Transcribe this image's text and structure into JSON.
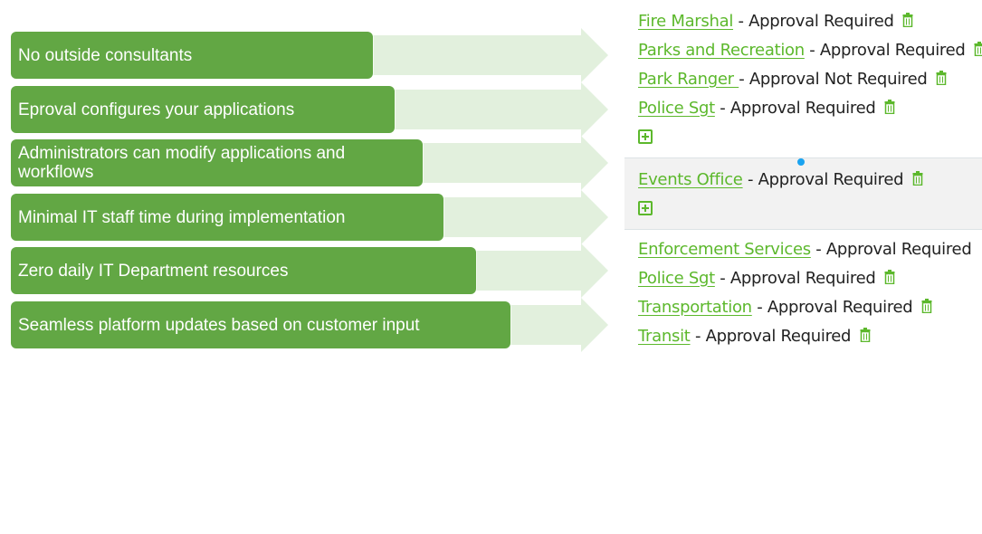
{
  "benefits": [
    "No outside consultants",
    "Eproval configures your applications",
    "Administrators can modify applications and workflows",
    "Minimal IT staff time during implementation",
    "Zero daily IT Department resources",
    "Seamless platform updates based on customer input"
  ],
  "colors": {
    "box_green": "#62a744",
    "arrow_green": "#e2f0dd",
    "link_green": "#5cb82c",
    "shaded_bg": "#f2f2f2",
    "cursor_blue": "#1aa3f0"
  },
  "approvals": {
    "group1": [
      {
        "name": "Fire Marshal",
        "status": "- Approval Required"
      },
      {
        "name": "Parks and Recreation",
        "status": "- Approval Required"
      },
      {
        "name": "Park Ranger ",
        "status": "- Approval Not Required"
      },
      {
        "name": "Police Sgt",
        "status": "- Approval Required"
      }
    ],
    "group2": [
      {
        "name": "Events Office",
        "status": "- Approval Required"
      }
    ],
    "group3": [
      {
        "name": "Enforcement Services",
        "status": "- Approval Required"
      },
      {
        "name": "Police Sgt",
        "status": "- Approval Required"
      },
      {
        "name": "Transportation",
        "status": "- Approval Required"
      },
      {
        "name": "Transit",
        "status": "- Approval Required"
      }
    ]
  }
}
